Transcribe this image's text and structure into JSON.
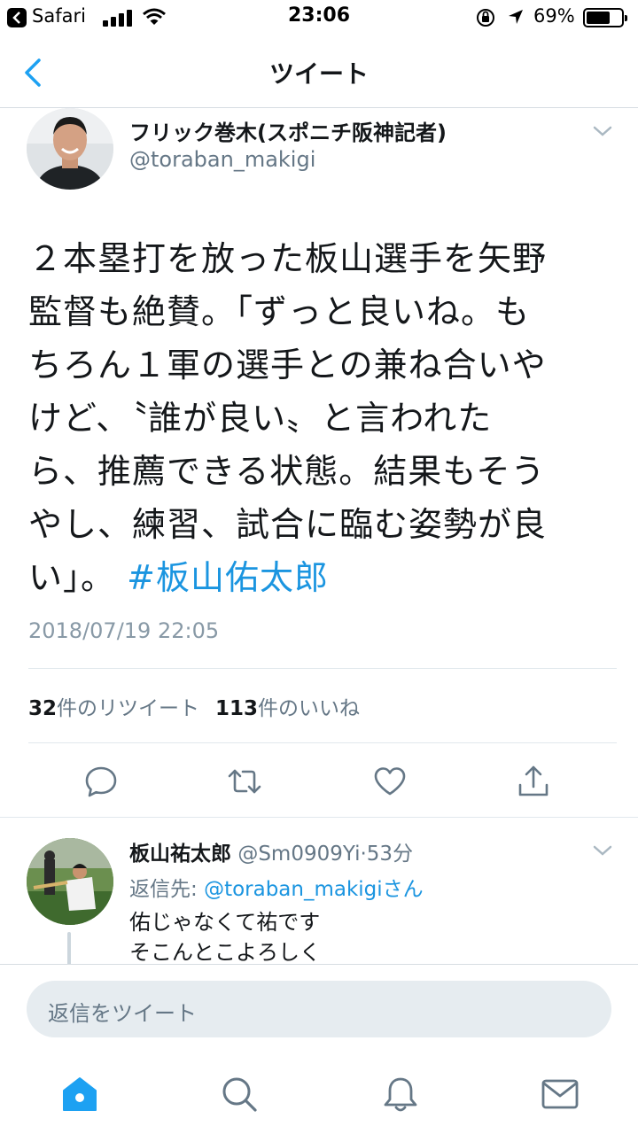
{
  "status_bar": {
    "app": "Safari",
    "time": "23:06",
    "battery": "69%",
    "battery_level": 0.69
  },
  "nav": {
    "title": "ツイート"
  },
  "tweet": {
    "author_name": "フリック巻木(スポニチ阪神記者)",
    "author_handle": "@toraban_makigi",
    "text_lines": [
      "２本塁打を放った板山選手を矢野",
      "監督も絶賛。「ずっと良いね。も",
      "ちろん１軍の選手との兼ね合いや",
      "けど、〝誰が良い〟と言われた",
      "ら、推薦できる状態。結果もそう",
      "やし、練習、試合に臨む姿勢が良"
    ],
    "last_line_text": "い」。",
    "hashtag": "#板山佑太郎",
    "date": "2018/07/19 22:05",
    "retweet_count": "32",
    "retweet_label": "件のリツイート",
    "like_count": "113",
    "like_label": "件のいいね"
  },
  "reply": {
    "name": "板山祐太郎",
    "handle": "@Sm0909Yi",
    "separator": "·",
    "time": "53分",
    "reply_to_prefix": "返信先: ",
    "reply_to_handle": "@toraban_makigiさん",
    "text_lines": [
      "佑じゃなくて祐です",
      "そこんとこよろしく"
    ]
  },
  "compose": {
    "placeholder": "返信をツイート"
  },
  "colors": {
    "accent": "#1da1f2",
    "link": "#1b95e0",
    "secondary_text": "#657786"
  },
  "icons": {
    "reply": "reply-icon",
    "retweet": "retweet-icon",
    "like": "heart-icon",
    "share": "share-icon",
    "home": "home-icon",
    "search": "search-icon",
    "notifications": "bell-icon",
    "messages": "mail-icon"
  }
}
